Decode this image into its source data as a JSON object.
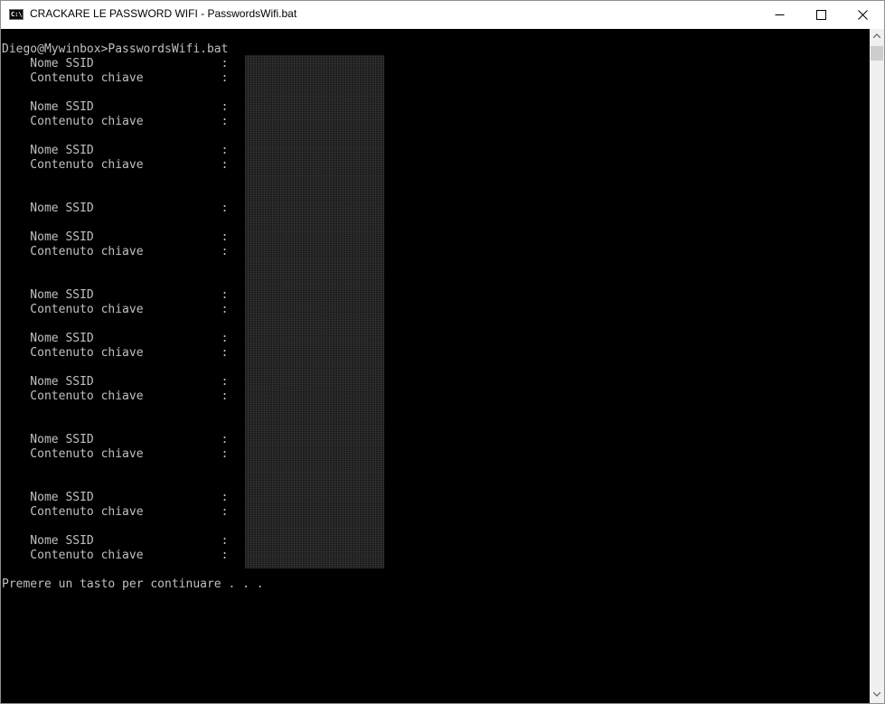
{
  "window": {
    "title": "CRACKARE LE PASSWORD WIFI - PasswordsWifi.bat",
    "icon_text": "C:\\"
  },
  "console": {
    "prompt": "Diego@Mywinbox>PasswordsWifi.bat",
    "lines": [
      {
        "row": 1,
        "text": "    Nome SSID                  :"
      },
      {
        "row": 2,
        "text": "    Contenuto chiave           :"
      },
      {
        "row": 4,
        "text": "    Nome SSID                  :"
      },
      {
        "row": 5,
        "text": "    Contenuto chiave           :"
      },
      {
        "row": 7,
        "text": "    Nome SSID                  :"
      },
      {
        "row": 8,
        "text": "    Contenuto chiave           :"
      },
      {
        "row": 11,
        "text": "    Nome SSID                  :"
      },
      {
        "row": 13,
        "text": "    Nome SSID                  :"
      },
      {
        "row": 14,
        "text": "    Contenuto chiave           :"
      },
      {
        "row": 17,
        "text": "    Nome SSID                  :"
      },
      {
        "row": 18,
        "text": "    Contenuto chiave           :"
      },
      {
        "row": 20,
        "text": "    Nome SSID                  :"
      },
      {
        "row": 21,
        "text": "    Contenuto chiave           :"
      },
      {
        "row": 23,
        "text": "    Nome SSID                  :"
      },
      {
        "row": 24,
        "text": "    Contenuto chiave           :"
      },
      {
        "row": 27,
        "text": "    Nome SSID                  :"
      },
      {
        "row": 28,
        "text": "    Contenuto chiave           :"
      },
      {
        "row": 31,
        "text": "    Nome SSID                  :"
      },
      {
        "row": 32,
        "text": "    Contenuto chiave           :"
      },
      {
        "row": 34,
        "text": "    Nome SSID                  :"
      },
      {
        "row": 35,
        "text": "    Contenuto chiave           :"
      }
    ],
    "footer": "Premere un tasto per continuare . . ."
  },
  "colors": {
    "console_bg": "#000000",
    "console_text": "#c0c0c0",
    "titlebar_bg": "#ffffff"
  },
  "icons": [
    "console-app-icon",
    "minimize-icon",
    "maximize-icon",
    "close-icon",
    "scroll-up-icon",
    "scroll-down-icon"
  ]
}
